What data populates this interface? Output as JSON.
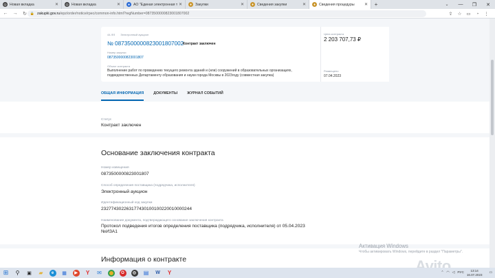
{
  "browser": {
    "tabs": [
      {
        "label": "Новая вкладка",
        "icon": "browser-icon",
        "color": "#3a3a3a",
        "active": false
      },
      {
        "label": "Новая вкладка",
        "icon": "browser-icon",
        "color": "#3a3a3a",
        "active": false
      },
      {
        "label": "АО \"Единая электронная торго...",
        "icon": "site-icon",
        "color": "#2a6bd6",
        "active": false
      },
      {
        "label": "Закупки",
        "icon": "emblem-icon",
        "color": "#c9952c",
        "active": false
      },
      {
        "label": "Сведения закупки",
        "icon": "emblem-icon",
        "color": "#c9952c",
        "active": false
      },
      {
        "label": "Сведения процедуры",
        "icon": "emblem-icon",
        "color": "#c9952c",
        "active": true
      }
    ],
    "url_host": "zakupki.gov.ru",
    "url_path": "/epz/order/notice/rpec/common-info.html?regNumber=0873500000823001807002"
  },
  "header": {
    "law": "44-ФЗ",
    "procedure_type": "Электронный аукцион",
    "procedure_id": "№ 0873500000823001807002",
    "status": "Контракт заключен",
    "notice_label": "Номер закупки",
    "notice_number": "0873500000823001807",
    "object_label": "Объект контракта",
    "object_text": "Выполнение работ по проведению текущего ремонта зданий и (или) сооружений в образовательных организациях, подведомственных Департаменту образования и науки города Москвы в 2023году (совместная закупка)",
    "price_label": "Цена контракта",
    "price": "2 203 707,73 ₽",
    "date_label": "Размещено",
    "date": "07.04.2023"
  },
  "tabs": [
    {
      "label": "ОБЩАЯ ИНФОРМАЦИЯ",
      "active": true
    },
    {
      "label": "ДОКУМЕНТЫ",
      "active": false
    },
    {
      "label": "ЖУРНАЛ СОБЫТИЙ",
      "active": false
    }
  ],
  "status_block": {
    "label": "Статус",
    "value": "Контракт заключен"
  },
  "basis": {
    "title": "Основание заключения контракта",
    "notice_label": "Номер извещения",
    "notice_value": "0873500000823001807",
    "method_label": "Способ определения поставщика (подрядчика, исполнителя)",
    "method_value": "Электронный аукцион",
    "ikz_label": "Идентификационный код закупки",
    "ikz_value": "232774302263177430100100220010000244",
    "doc_label": "Наименование документа, подтверждающего основание заключения контракта",
    "doc_value_line1": "Протокол подведения итогов определения поставщика (подрядчика, исполнителя) от 05.04.2023",
    "doc_value_line2": "№ИЗА1"
  },
  "contract_info": {
    "title": "Информация о контракте"
  },
  "watermark": {
    "line1": "Активация Windows",
    "line2": "Чтобы активировать Windows, перейдите в раздел \"Параметры\".",
    "brand": "Avito"
  },
  "taskbar": {
    "lang": "РУС",
    "time": "13:14",
    "date": "16.07.2023"
  }
}
